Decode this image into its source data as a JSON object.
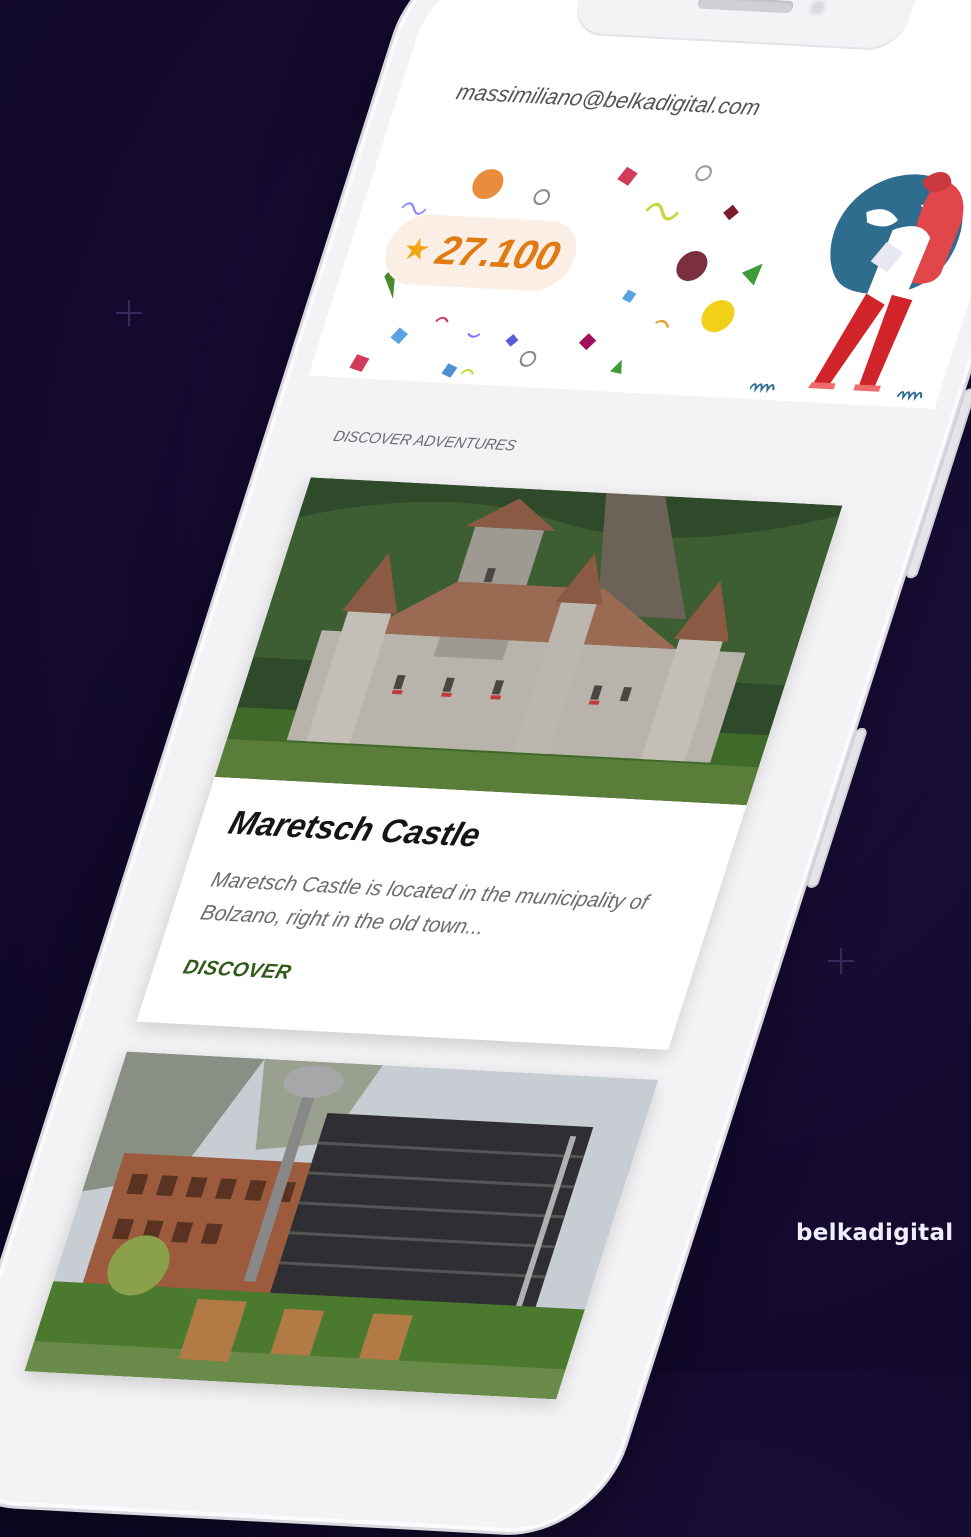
{
  "header": {
    "email": "massimiliano@belkadigital.com",
    "points": "27.100",
    "icons": {
      "star": "star-icon",
      "menu": "more-vertical-icon"
    }
  },
  "section": {
    "title": "DISCOVER ADVENTURES"
  },
  "cards": [
    {
      "title": "Maretsch Castle",
      "description": "Maretsch Castle is located in the municipality of Bolzano, right in the old town...",
      "action": "DISCOVER"
    }
  ],
  "branding": {
    "text": "belkadigital"
  },
  "colors": {
    "background": "#140a30",
    "points_text": "#e07b14",
    "star": "#f0a515",
    "badge_bg": "#fbeee4",
    "action_text": "#2f5a1a"
  }
}
